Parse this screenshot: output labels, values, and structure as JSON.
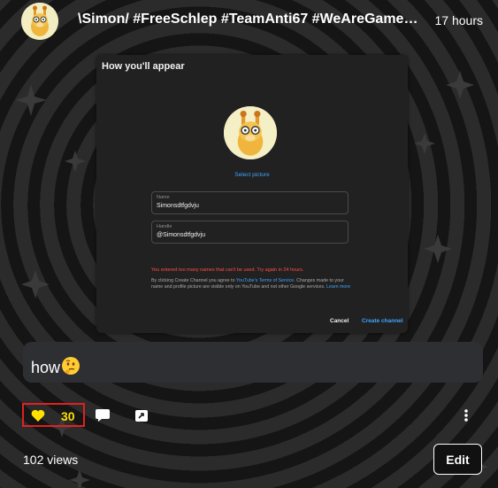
{
  "post": {
    "author": "\\Simon/ #FreeSchlep #TeamAnti67 #WeAreGameJo...",
    "time": "17 hours",
    "comment": "how",
    "likes": "30",
    "views": "102 views",
    "edit_label": "Edit"
  },
  "screenshot": {
    "title": "How you'll appear",
    "select_picture": "Select picture",
    "name_label": "Name",
    "name_value": "Simonsdtfgdvju",
    "handle_label": "Handle",
    "handle_value": "@Simonsdtfgdvju",
    "error": "You entered too many names that can't be used. Try again in 24 hours.",
    "terms_prefix": "By clicking Create Channel you agree to ",
    "terms_link": "YouTube's Terms of Service",
    "terms_rest": ". Changes made to your name and profile picture are visible only on YouTube and not other Google services. ",
    "learn_more": "Learn more",
    "cancel": "Cancel",
    "create": "Create channel"
  },
  "icons": {
    "like": "heart-icon",
    "comment": "comment-icon",
    "share": "share-icon",
    "more": "more-vertical-icon",
    "emoji": "thinking-face-icon"
  },
  "colors": {
    "like_border": "#e02020",
    "like_count": "#ffe000",
    "link": "#3ea6ff",
    "error": "#ff4e45"
  }
}
